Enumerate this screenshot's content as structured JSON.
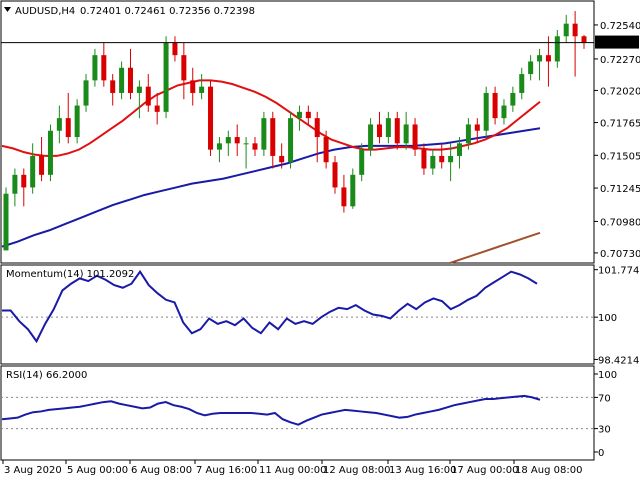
{
  "header": {
    "symbol_tf": "AUDUSD,H4",
    "ohlc": "0.72401 0.72461 0.72356 0.72398",
    "dropdown_icon": "triangle-down-icon"
  },
  "colors": {
    "bull_candle": "#1a8a1a",
    "bear_candle": "#d90000",
    "ma_fast": "#e01010",
    "ma_mid": "#1a1aa8",
    "ma_slow": "#a0522d",
    "indicator": "#1a1aa8",
    "price_label_bg": "#000000"
  },
  "chart_data": [
    {
      "type": "candlestick",
      "title": "AUDUSD,H4",
      "ylim": [
        0.7065,
        0.7273
      ],
      "y_ticks": [
        "0.72540",
        "0.72270",
        "0.72020",
        "0.71765",
        "0.71505",
        "0.71245",
        "0.70980",
        "0.70730"
      ],
      "current_price_label": "0.72398",
      "x_ticks": [
        "3 Aug 2020",
        "5 Aug 00:00",
        "6 Aug 08:00",
        "7 Aug 16:00",
        "11 Aug 00:00",
        "12 Aug 08:00",
        "13 Aug 16:00",
        "17 Aug 00:00",
        "18 Aug 08:00"
      ],
      "candles": [
        [
          0.7075,
          0.7125,
          0.7075,
          0.712
        ],
        [
          0.712,
          0.714,
          0.711,
          0.7135
        ],
        [
          0.7135,
          0.714,
          0.711,
          0.7125
        ],
        [
          0.7125,
          0.716,
          0.712,
          0.715
        ],
        [
          0.715,
          0.7165,
          0.713,
          0.7135
        ],
        [
          0.7135,
          0.7175,
          0.713,
          0.717
        ],
        [
          0.717,
          0.719,
          0.716,
          0.718
        ],
        [
          0.718,
          0.72,
          0.716,
          0.7165
        ],
        [
          0.7165,
          0.7195,
          0.716,
          0.719
        ],
        [
          0.719,
          0.7215,
          0.7185,
          0.721
        ],
        [
          0.721,
          0.7235,
          0.7205,
          0.723
        ],
        [
          0.723,
          0.724,
          0.7205,
          0.721
        ],
        [
          0.721,
          0.7215,
          0.719,
          0.72
        ],
        [
          0.72,
          0.7225,
          0.7195,
          0.722
        ],
        [
          0.722,
          0.7235,
          0.7195,
          0.72
        ],
        [
          0.72,
          0.721,
          0.718,
          0.7205
        ],
        [
          0.7205,
          0.7215,
          0.7185,
          0.719
        ],
        [
          0.719,
          0.72,
          0.7175,
          0.7185
        ],
        [
          0.7185,
          0.7245,
          0.718,
          0.724
        ],
        [
          0.724,
          0.7245,
          0.7225,
          0.723
        ],
        [
          0.723,
          0.724,
          0.7195,
          0.721
        ],
        [
          0.721,
          0.722,
          0.719,
          0.72
        ],
        [
          0.72,
          0.7215,
          0.7195,
          0.7205
        ],
        [
          0.7205,
          0.721,
          0.715,
          0.7155
        ],
        [
          0.7155,
          0.7165,
          0.7145,
          0.716
        ],
        [
          0.716,
          0.717,
          0.715,
          0.7165
        ],
        [
          0.7165,
          0.7175,
          0.715,
          0.716
        ],
        [
          0.716,
          0.7165,
          0.714,
          0.716
        ],
        [
          0.716,
          0.7165,
          0.715,
          0.7155
        ],
        [
          0.7155,
          0.7185,
          0.715,
          0.718
        ],
        [
          0.718,
          0.7185,
          0.714,
          0.715
        ],
        [
          0.715,
          0.716,
          0.714,
          0.7145
        ],
        [
          0.7145,
          0.7185,
          0.714,
          0.718
        ],
        [
          0.718,
          0.719,
          0.717,
          0.7185
        ],
        [
          0.7185,
          0.719,
          0.7175,
          0.718
        ],
        [
          0.718,
          0.7185,
          0.7145,
          0.7165
        ],
        [
          0.7165,
          0.717,
          0.714,
          0.7145
        ],
        [
          0.7145,
          0.715,
          0.712,
          0.7125
        ],
        [
          0.7125,
          0.7135,
          0.7105,
          0.711
        ],
        [
          0.711,
          0.714,
          0.7108,
          0.7135
        ],
        [
          0.7135,
          0.716,
          0.713,
          0.7155
        ],
        [
          0.7155,
          0.718,
          0.715,
          0.7175
        ],
        [
          0.7175,
          0.7185,
          0.716,
          0.7165
        ],
        [
          0.7165,
          0.7185,
          0.716,
          0.718
        ],
        [
          0.718,
          0.7185,
          0.7155,
          0.716
        ],
        [
          0.716,
          0.7185,
          0.7155,
          0.7175
        ],
        [
          0.7175,
          0.718,
          0.715,
          0.7155
        ],
        [
          0.7155,
          0.716,
          0.7135,
          0.714
        ],
        [
          0.714,
          0.7155,
          0.7135,
          0.715
        ],
        [
          0.715,
          0.716,
          0.714,
          0.7145
        ],
        [
          0.7145,
          0.716,
          0.713,
          0.715
        ],
        [
          0.715,
          0.7165,
          0.714,
          0.716
        ],
        [
          0.716,
          0.718,
          0.7155,
          0.7175
        ],
        [
          0.7175,
          0.718,
          0.716,
          0.717
        ],
        [
          0.717,
          0.7205,
          0.7165,
          0.72
        ],
        [
          0.72,
          0.7205,
          0.7175,
          0.718
        ],
        [
          0.718,
          0.7195,
          0.7175,
          0.719
        ],
        [
          0.719,
          0.7205,
          0.7185,
          0.72
        ],
        [
          0.72,
          0.722,
          0.7195,
          0.7215
        ],
        [
          0.7215,
          0.723,
          0.721,
          0.7225
        ],
        [
          0.7225,
          0.7235,
          0.721,
          0.723
        ],
        [
          0.723,
          0.7245,
          0.7205,
          0.7225
        ],
        [
          0.7225,
          0.725,
          0.722,
          0.7245
        ],
        [
          0.7245,
          0.7262,
          0.724,
          0.7255
        ],
        [
          0.7255,
          0.7265,
          0.7213,
          0.7245
        ],
        [
          0.7245,
          0.7246,
          0.7235,
          0.724
        ]
      ],
      "ma_fast": [
        0.7158,
        0.7156,
        0.7153,
        0.7151,
        0.715,
        0.715,
        0.7152,
        0.7155,
        0.716,
        0.7166,
        0.7172,
        0.7178,
        0.7185,
        0.7192,
        0.7198,
        0.7202,
        0.7206,
        0.7208,
        0.721,
        0.721,
        0.7209,
        0.7207,
        0.7204,
        0.7201,
        0.7197,
        0.7192,
        0.7186,
        0.718,
        0.7174,
        0.7168,
        0.7163,
        0.716,
        0.7157,
        0.7155,
        0.7155,
        0.7156,
        0.7157,
        0.7157,
        0.7156,
        0.7155,
        0.7155,
        0.7156,
        0.7158,
        0.716,
        0.7163,
        0.7167,
        0.7172,
        0.7179,
        0.7186,
        0.7193
      ],
      "ma_mid": [
        0.7078,
        0.7082,
        0.7087,
        0.7091,
        0.7096,
        0.7101,
        0.7106,
        0.7111,
        0.7115,
        0.7119,
        0.7122,
        0.7125,
        0.7128,
        0.713,
        0.7132,
        0.7135,
        0.7138,
        0.7141,
        0.7144,
        0.7148,
        0.7152,
        0.7155,
        0.7157,
        0.7158,
        0.7158,
        0.7158,
        0.7158,
        0.7159,
        0.716,
        0.7162,
        0.7164,
        0.7166,
        0.7168,
        0.717,
        0.7172
      ],
      "ma_slow": [
        0.7065,
        0.7068,
        0.7071,
        0.7074,
        0.7077,
        0.708,
        0.7083,
        0.7086,
        0.7089
      ]
    },
    {
      "type": "line",
      "title": "Momentum(14) 101.2092",
      "series": [
        {
          "name": "Momentum(14)",
          "values": [
            100.25,
            100.25,
            99.85,
            99.55,
            99.1,
            99.75,
            100.3,
            101.0,
            101.25,
            101.45,
            101.35,
            101.55,
            101.4,
            101.2,
            101.1,
            101.25,
            101.7,
            101.2,
            100.9,
            100.65,
            100.55,
            99.8,
            99.4,
            99.55,
            99.95,
            99.75,
            99.85,
            99.7,
            99.95,
            99.6,
            99.4,
            99.8,
            99.55,
            99.95,
            99.75,
            99.85,
            99.75,
            100.0,
            100.2,
            100.35,
            100.3,
            100.45,
            100.25,
            100.1,
            100.05,
            99.95,
            100.25,
            100.5,
            100.3,
            100.55,
            100.7,
            100.6,
            100.3,
            100.45,
            100.65,
            100.8,
            101.1,
            101.3,
            101.5,
            101.7,
            101.6,
            101.45,
            101.25
          ]
        }
      ],
      "ylim": [
        98.25,
        101.95
      ],
      "y_ticks": [
        "101.7748",
        "100",
        "98.4214"
      ],
      "reference_level": 100
    },
    {
      "type": "line",
      "title": "RSI(14) 66.2000",
      "series": [
        {
          "name": "RSI(14)",
          "values": [
            42,
            43,
            44,
            48,
            51,
            52,
            54,
            55,
            56,
            57,
            58,
            60,
            62,
            64,
            65,
            62,
            60,
            58,
            56,
            57,
            62,
            64,
            60,
            58,
            55,
            50,
            47,
            49,
            50,
            50,
            50,
            50,
            50,
            49,
            48,
            50,
            42,
            38,
            35,
            40,
            44,
            48,
            50,
            52,
            54,
            53,
            52,
            51,
            50,
            48,
            46,
            44,
            45,
            48,
            50,
            52,
            54,
            57,
            60,
            62,
            64,
            66,
            68,
            68,
            69,
            70,
            71,
            72,
            70,
            67
          ]
        }
      ],
      "ylim": [
        0,
        100
      ],
      "y_ticks": [
        "100",
        "70",
        "30",
        "0"
      ],
      "levels": [
        70,
        30
      ]
    }
  ]
}
